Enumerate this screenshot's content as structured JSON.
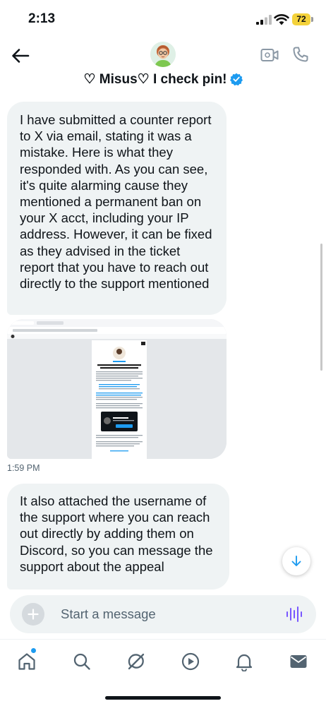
{
  "status_bar": {
    "time": "2:13",
    "battery_level": "72",
    "icons": [
      "signal-icon",
      "wifi-icon",
      "battery-icon"
    ]
  },
  "header": {
    "name": "♡ Misus♡ I check pin!",
    "verified": true,
    "icons": [
      "back-arrow-icon",
      "video-call-icon",
      "phone-call-icon"
    ]
  },
  "messages": [
    {
      "type": "text",
      "text": "I have submitted a counter report to X via email, stating it was a mistake. Here is what they responded with.  As you can see, it's quite alarming cause they mentioned a permanent ban on your X acct, including your IP address. However, it can be fixed as they advised in the ticket report that you have to reach out directly to the support mentioned"
    },
    {
      "type": "image",
      "description_icon": "attached-screenshot-image",
      "timestamp": "1:59 PM"
    },
    {
      "type": "text",
      "text": "It also attached the username of the support where you can reach out directly by adding them on Discord, so you can message the support about the appeal"
    }
  ],
  "composer": {
    "placeholder": "Start a message",
    "value": "",
    "icons": [
      "add-icon",
      "voice-message-icon"
    ]
  },
  "bottom_nav": {
    "items": [
      "home-icon",
      "search-icon",
      "grok-icon",
      "video-icon",
      "notifications-icon",
      "messages-icon"
    ],
    "active": "messages-icon"
  },
  "colors": {
    "accent": "#1d9bf0",
    "bubble": "#eff3f4",
    "text": "#0f1419",
    "secondary_text": "#536471",
    "voice_purple": "#7856ff",
    "battery": "#f4d23b"
  }
}
